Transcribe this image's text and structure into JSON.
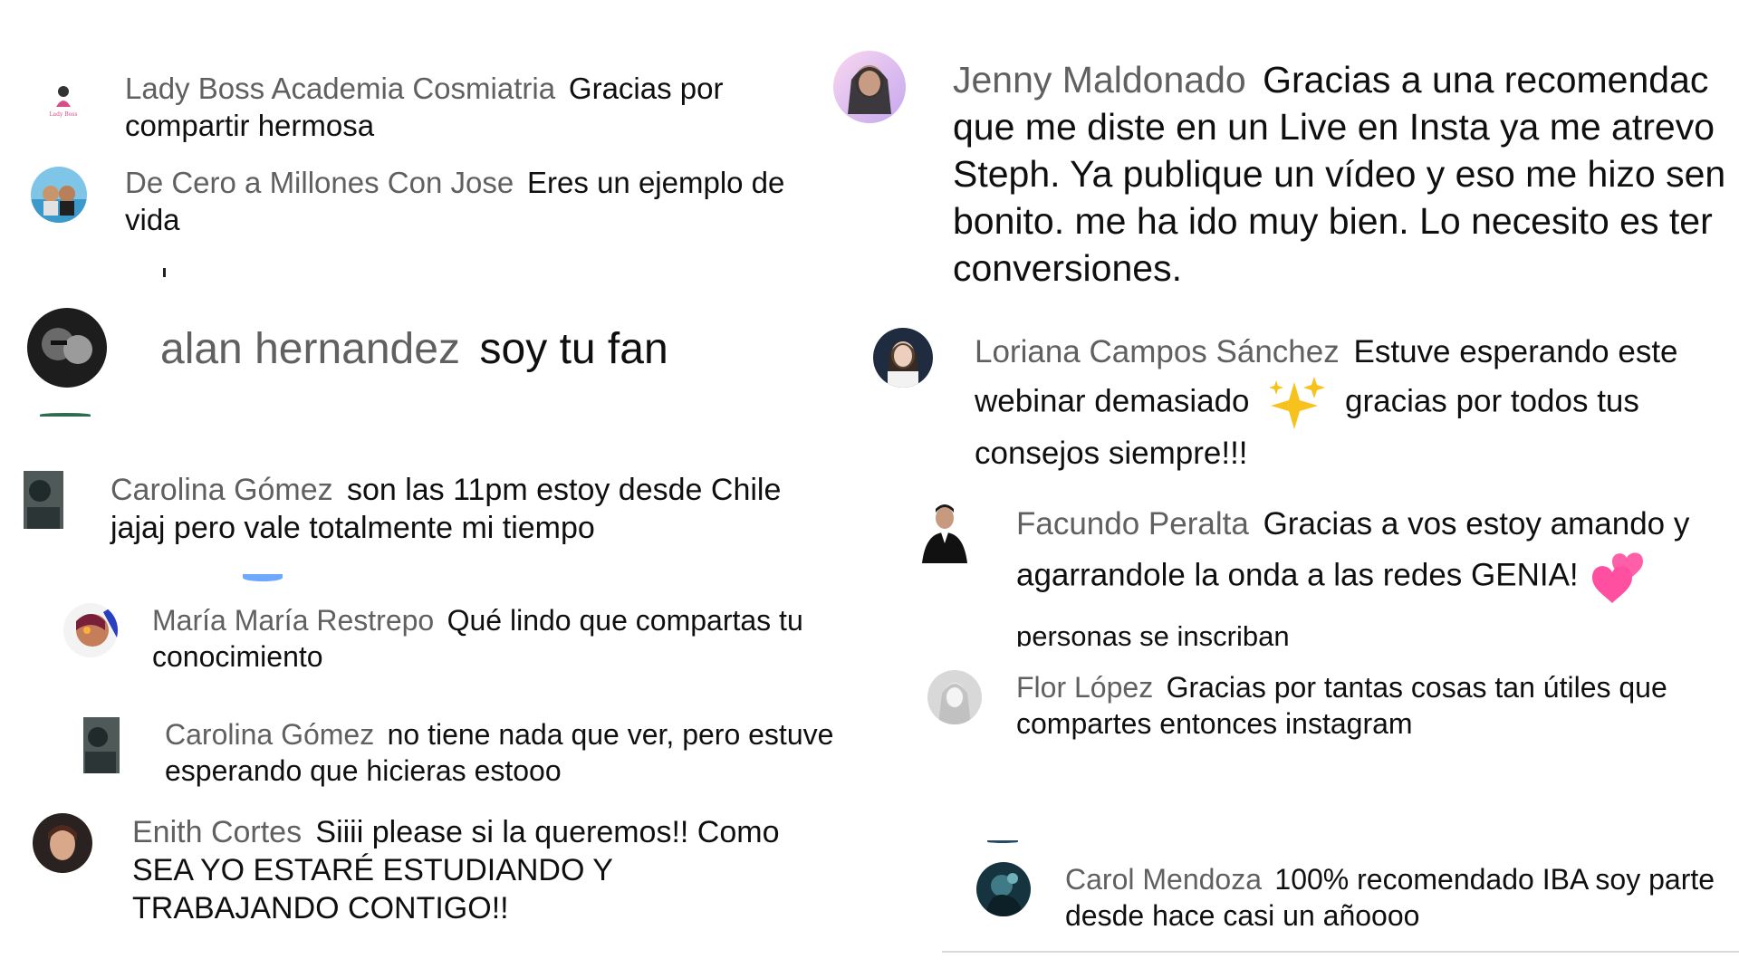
{
  "comments": [
    {
      "id": "lady-boss",
      "author": "Lady Boss Academia Cosmiatria",
      "text": "Gracias por compartir hermosa"
    },
    {
      "id": "de-cero",
      "author": "De Cero a Millones Con Jose",
      "text": "Eres un ejemplo de vida"
    },
    {
      "id": "alan",
      "author": "alan hernandez",
      "text": "soy tu fan"
    },
    {
      "id": "carolina-1",
      "author": "Carolina Gómez",
      "text": "son las 11pm estoy desde Chile jajaj pero vale totalmente mi tiempo"
    },
    {
      "id": "maria",
      "author": "María María Restrepo",
      "text": "Qué lindo que compartas tu conocimiento"
    },
    {
      "id": "carolina-2",
      "author": "Carolina Gómez",
      "text": "no tiene nada que ver, pero estuve esperando que hicieras estooo"
    },
    {
      "id": "enith",
      "author": "Enith Cortes",
      "text": "Siiii please si la queremos!! Como SEA YO ESTARÉ ESTUDIANDO Y TRABAJANDO CONTIGO!!"
    },
    {
      "id": "jenny",
      "author": "Jenny Maldonado",
      "text": "Gracias a una recomendac",
      "text_lines": [
        "que me diste en un Live en Insta ya me atrevo",
        "Steph. Ya publique un vídeo y eso me hizo sen",
        "bonito. me ha ido muy bien. Lo necesito es ter",
        "conversiones."
      ]
    },
    {
      "id": "loriana",
      "author": "Loriana Campos Sánchez",
      "text": "Estuve esperando este",
      "text_2": "webinar demasiado",
      "text_3": "gracias por todos tus",
      "text_4": "consejos siempre!!!",
      "emoji": "sparkles-emoji"
    },
    {
      "id": "facundo",
      "author": "Facundo Peralta",
      "text": "Gracias a vos estoy amando y",
      "text_2": "agarrandole la onda a las redes GENIA!",
      "emoji": "two-hearts-emoji"
    },
    {
      "id": "flor",
      "author": "Flor López",
      "text": "Gracias por tantas cosas tan útiles que compartes entonces instagram"
    },
    {
      "id": "carol",
      "author": "Carol Mendoza",
      "text": "100% recomendado IBA soy parte desde hace casi un añoooo"
    }
  ],
  "fragments": {
    "personas": "personas se inscriban"
  },
  "colors": {
    "author": "#606060",
    "text": "#0f0f0f",
    "background": "#ffffff"
  }
}
